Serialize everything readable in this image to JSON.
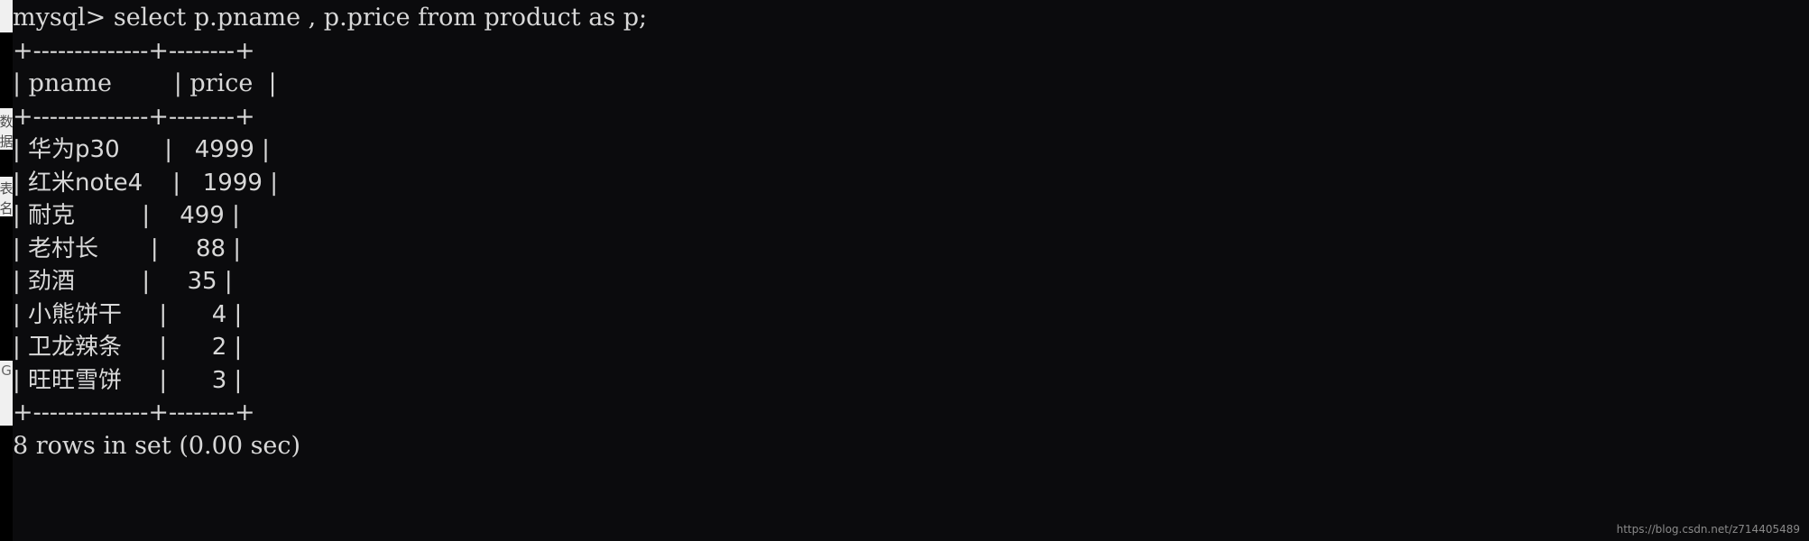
{
  "terminal": {
    "prompt": "mysql> ",
    "query": "select p.pname , p.price from product as p;",
    "border_top": "+--------------+--------+",
    "header_row": "|  pname       |  price |",
    "border_mid": "+--------------+--------+",
    "border_bottom": "+--------------+--------+",
    "footer": "8 rows in set (0.00 sec)",
    "columns": [
      "pname",
      "price"
    ],
    "rows": [
      {
        "pname": "华为p30",
        "price": "4999"
      },
      {
        "pname": "红米note4",
        "price": "1999"
      },
      {
        "pname": "耐克",
        "price": "499"
      },
      {
        "pname": "老村长",
        "price": "88"
      },
      {
        "pname": "劲酒",
        "price": "35"
      },
      {
        "pname": "小熊饼干",
        "price": "4"
      },
      {
        "pname": "卫龙辣条",
        "price": "2"
      },
      {
        "pname": "旺旺雪饼",
        "price": "3"
      }
    ],
    "row_count": 8,
    "elapsed": "0.00 sec",
    "colors": {
      "background": "#0b0b0d",
      "text": "#d8d8d8",
      "gutter": "#f0f0f0"
    }
  },
  "gutter": {
    "ghost_chars": [
      "数",
      "据",
      "表",
      "名",
      "G"
    ]
  },
  "watermark": {
    "text": "https://blog.csdn.net/z714405489"
  }
}
